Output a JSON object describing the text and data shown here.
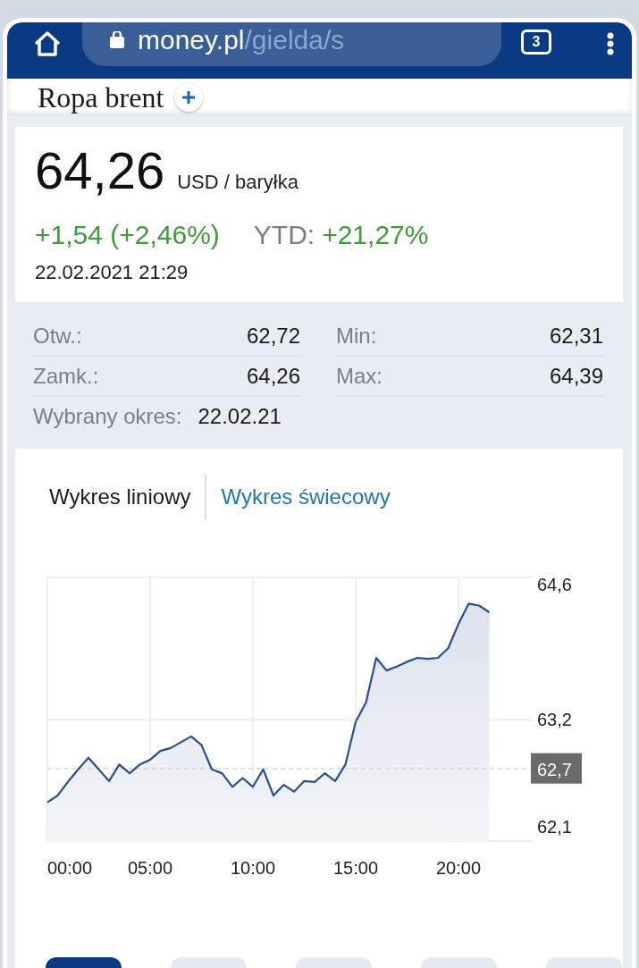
{
  "browser": {
    "url_host": "money.pl",
    "url_path": "/gielda/s",
    "tab_count": "3"
  },
  "title": "Ropa brent",
  "quote": {
    "price": "64,26",
    "unit": "USD / baryłka",
    "change": "+1,54 (+2,46%)",
    "ytd_label": "YTD:",
    "ytd_value": "+21,27%",
    "timestamp": "22.02.2021 21:29"
  },
  "stats": {
    "rows": [
      [
        {
          "label": "Otw.:",
          "value": "62,72"
        },
        {
          "label": "Min:",
          "value": "62,31"
        }
      ],
      [
        {
          "label": "Zamk.:",
          "value": "64,26"
        },
        {
          "label": "Max:",
          "value": "64,39"
        }
      ]
    ],
    "period_label": "Wybrany okres:",
    "period_value": "22.02.21"
  },
  "chart_tabs": [
    {
      "label": "Wykres liniowy",
      "selected": true
    },
    {
      "label": "Wykres świecowy",
      "selected": false
    }
  ],
  "chart_data": {
    "type": "area",
    "x": [
      0,
      0.5,
      1,
      1.5,
      2,
      2.5,
      3,
      3.5,
      4,
      4.5,
      5,
      5.5,
      6,
      6.5,
      7,
      7.5,
      8,
      8.5,
      9,
      9.5,
      10,
      10.5,
      11,
      11.5,
      12,
      12.5,
      13,
      13.5,
      14,
      14.5,
      15,
      15.5,
      16,
      16.5,
      17,
      17.5,
      18,
      18.5,
      19,
      19.5,
      20,
      20.5,
      21,
      21.5
    ],
    "series": [
      {
        "color": "#2b4f8c",
        "values": [
          62.35,
          62.42,
          62.56,
          62.69,
          62.81,
          62.69,
          62.57,
          62.74,
          62.65,
          62.74,
          62.79,
          62.88,
          62.91,
          62.97,
          63.03,
          62.94,
          62.69,
          62.65,
          62.51,
          62.6,
          62.51,
          62.69,
          62.42,
          62.53,
          62.46,
          62.57,
          62.56,
          62.65,
          62.57,
          62.74,
          63.18,
          63.38,
          63.84,
          63.71,
          63.75,
          63.8,
          63.84,
          63.83,
          63.84,
          63.94,
          64.19,
          64.4,
          64.38,
          64.31
        ]
      }
    ],
    "xlim": [
      0,
      23.65
    ],
    "grid": true,
    "ylim": [
      61.95,
      64.67
    ],
    "xticks": [
      {
        "value": 0,
        "label": "00:00"
      },
      {
        "value": 5,
        "label": "05:00"
      },
      {
        "value": 10,
        "label": "10:00"
      },
      {
        "value": 15,
        "label": "15:00"
      },
      {
        "value": 20,
        "label": "20:00"
      }
    ],
    "yticks": [
      {
        "value": 64.6,
        "label": "64,6"
      },
      {
        "value": 63.2,
        "label": "63,2"
      },
      {
        "value": 62.1,
        "label": "62,1"
      }
    ],
    "ref_lines": [
      {
        "axis": "y",
        "value": 62.7,
        "label": "62,7"
      }
    ]
  }
}
